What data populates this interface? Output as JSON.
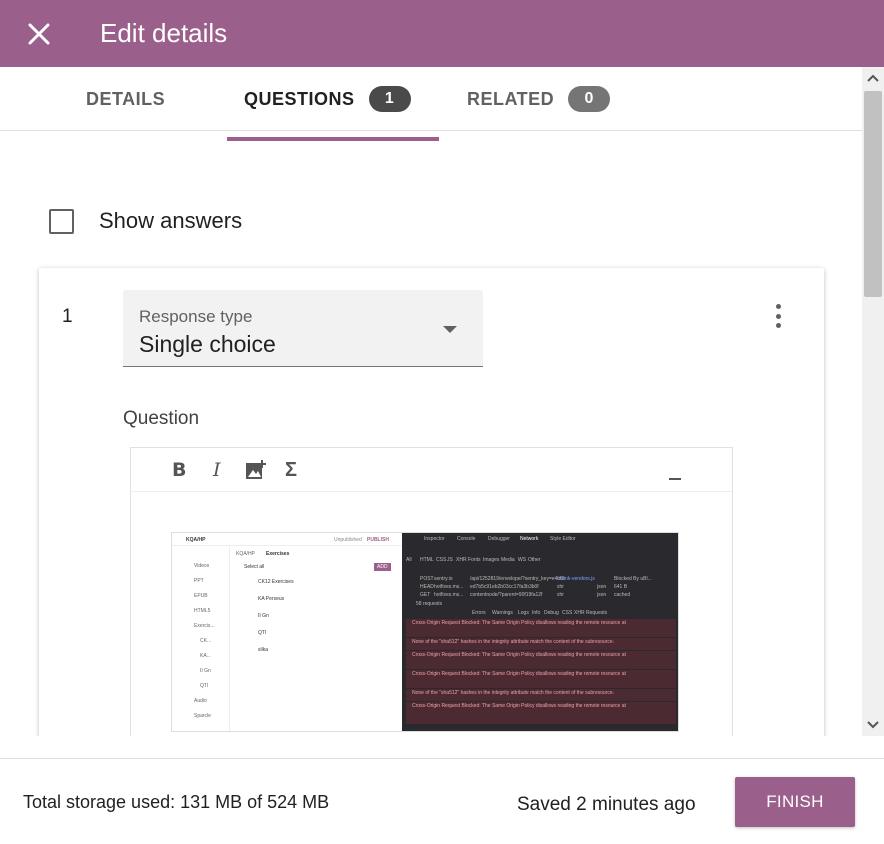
{
  "appbar": {
    "title": "Edit details",
    "color": "#9b5f8b"
  },
  "tabs": [
    {
      "label": "DETAILS",
      "badge": null
    },
    {
      "label": "QUESTIONS",
      "badge": "1",
      "active": true
    },
    {
      "label": "RELATED",
      "badge": "0"
    }
  ],
  "show_answers": {
    "label": "Show answers",
    "checked": false
  },
  "question": {
    "number": "1",
    "response_type_label": "Response type",
    "response_type_value": "Single choice",
    "question_label": "Question",
    "toolbar": [
      "bold-icon",
      "italic-icon",
      "add-image-icon",
      "formula-icon",
      "minimize-icon"
    ]
  },
  "embedded_screenshot": {
    "app_title": "KQA/HP",
    "status_unpublished": "Unpublished",
    "publish": "PUBLISH",
    "breadcrumb_root": "KQA/HP",
    "breadcrumb_current": "Exercises",
    "select_all": "Select all",
    "add_button": "ADD",
    "items": [
      "CK12 Exercises",
      "KA Perseus",
      "II Gn",
      "QTI",
      "slika"
    ],
    "sidebar_items": [
      "Videos",
      "PPT",
      "EPUB",
      "HTML5",
      "Exercis...",
      "CK...",
      "KA...",
      "II Gn",
      "QTI",
      "Audio",
      "Sparcle"
    ],
    "devtools_tabs": [
      "Inspector",
      "Console",
      "Debugger",
      "Network",
      "Style Editor"
    ],
    "network_filters": [
      "All",
      "HTML",
      "CSS",
      "JS",
      "XHR",
      "Fonts",
      "Images",
      "Media",
      "WS",
      "Other"
    ],
    "network_rows": [
      {
        "status": "POST",
        "domain": "sentry.io",
        "file": "/api/1252819/envelope/?sentry_key=e4b0f",
        "initiator": "chunk-vendors.js",
        "type": "",
        "transferred": "Blocked By uBl..."
      },
      {
        "status": "HEAD",
        "domain": "hotfixes.ms...",
        "file": "ed7b5c91eb2b03cc17fa3b3b0f",
        "initiator": "xhr",
        "type": "json",
        "transferred": "641 B"
      },
      {
        "status": "GET",
        "domain": "hotfixes.ms...",
        "file": "contentnode/?parent=90f19fa12f",
        "initiator": "xhr",
        "type": "json",
        "transferred": "cached"
      }
    ],
    "network_summary": "58 requests",
    "console_tabs": [
      "Errors",
      "Warnings",
      "Logs",
      "Info",
      "Debug",
      "CSS",
      "XHR",
      "Requests"
    ],
    "console_messages": [
      "Cross-Origin Request Blocked: The Same Origin Policy disallows reading the remote resource at",
      "None of the \"sha512\" hashes in the integrity attribute match the content of the subresource.",
      "Cross-Origin Request Blocked: The Same Origin Policy disallows reading the remote resource at",
      "Cross-Origin Request Blocked: The Same Origin Policy disallows reading the remote resource at",
      "None of the \"sha512\" hashes in the integrity attribute match the content of the subresource.",
      "Cross-Origin Request Blocked: The Same Origin Policy disallows reading the remote resource at"
    ]
  },
  "footer": {
    "storage": "Total storage used: 131 MB of 524 MB",
    "saved": "Saved 2 minutes ago",
    "finish_label": "FINISH"
  }
}
